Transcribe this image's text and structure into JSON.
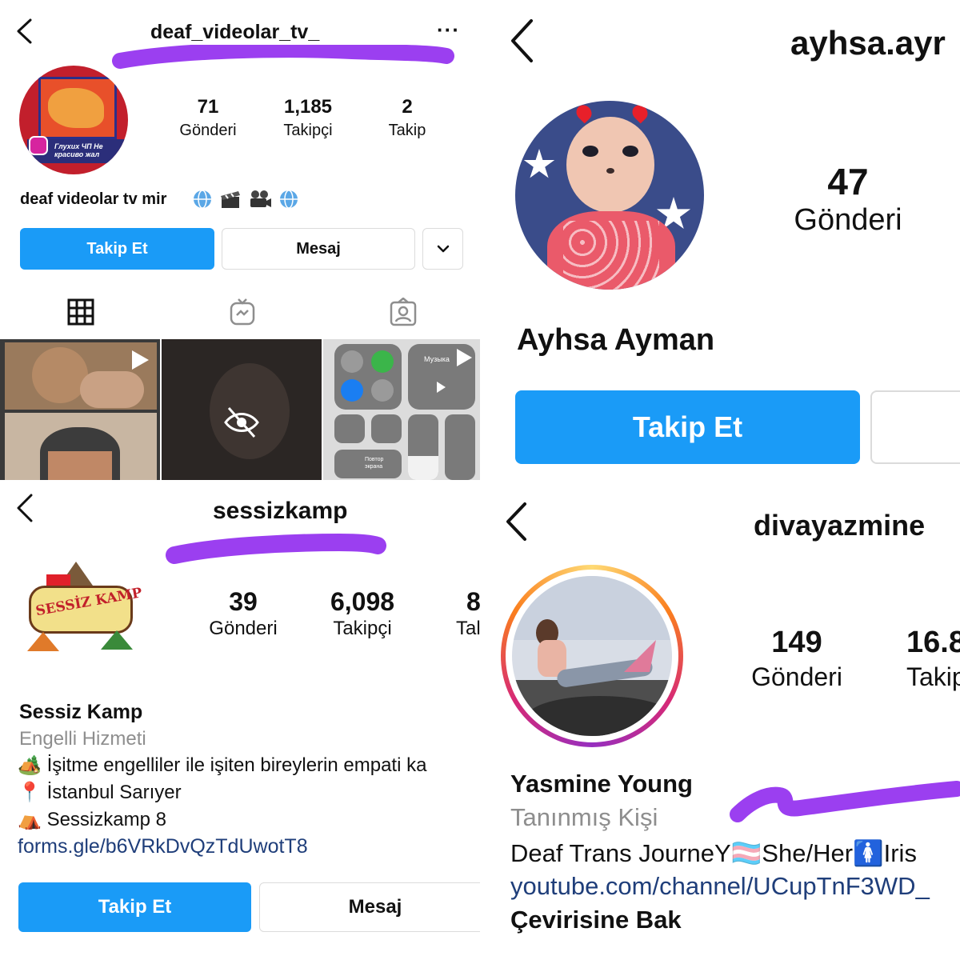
{
  "panels": {
    "p1": {
      "username": "deaf_videolar_tv_",
      "more": "···",
      "stats": [
        {
          "value": "71",
          "label": "Gönderi"
        },
        {
          "value": "1,185",
          "label": "Takipçi"
        },
        {
          "value": "2",
          "label": "Takip"
        }
      ],
      "bio_name": "deaf videolar tv  mir",
      "bio_icons": [
        "globe-icon",
        "clapper-icon",
        "camera-icon",
        "globe-icon"
      ],
      "follow_label": "Takip Et",
      "message_label": "Mesaj",
      "tabs": [
        "grid-icon",
        "igtv-icon",
        "tagged-icon"
      ],
      "avatar_text": "Глухих ЧП Не красиво жал",
      "thumb_text": "Музыка",
      "thumb_text2": "Повтор экрана"
    },
    "p2": {
      "username": "ayhsa.ayr",
      "stats": [
        {
          "value": "47",
          "label": "Gönderi"
        }
      ],
      "name": "Ayhsa Ayman",
      "follow_label": "Takip Et"
    },
    "p3": {
      "username": "sessizkamp",
      "stats": [
        {
          "value": "39",
          "label": "Gönderi"
        },
        {
          "value": "6,098",
          "label": "Takipçi"
        },
        {
          "value": "8",
          "label": "Tal"
        }
      ],
      "name": "Sessiz Kamp",
      "category": "Engelli Hizmeti",
      "bio_lines": [
        {
          "emoji": "🏕️",
          "text": "İşitme engelliler ile işiten bireylerin empati ka"
        },
        {
          "emoji": "📍",
          "text": "İstanbul Sarıyer"
        },
        {
          "emoji": "⛺",
          "text": "Sessizkamp 8"
        }
      ],
      "link": "forms.gle/b6VRkDvQzTdUwotT8",
      "follow_label": "Takip Et",
      "message_label": "Mesaj",
      "logo_text": "SESSİZ KAMP"
    },
    "p4": {
      "username": "divayazmine",
      "stats": [
        {
          "value": "149",
          "label": "Gönderi"
        },
        {
          "value": "16.8",
          "label": "Takip"
        }
      ],
      "name": "Yasmine Young",
      "category": "Tanınmış Kişi",
      "bio": "Deaf Trans JourneY🏳️‍⚧️She/Her🚺Iris",
      "link": "youtube.com/channel/UCupTnF3WD_",
      "translate": "Çevirisine Bak"
    }
  },
  "colors": {
    "accent": "#1a9bf7",
    "scribble": "#9b3ff0",
    "link": "#1f3e7a"
  }
}
